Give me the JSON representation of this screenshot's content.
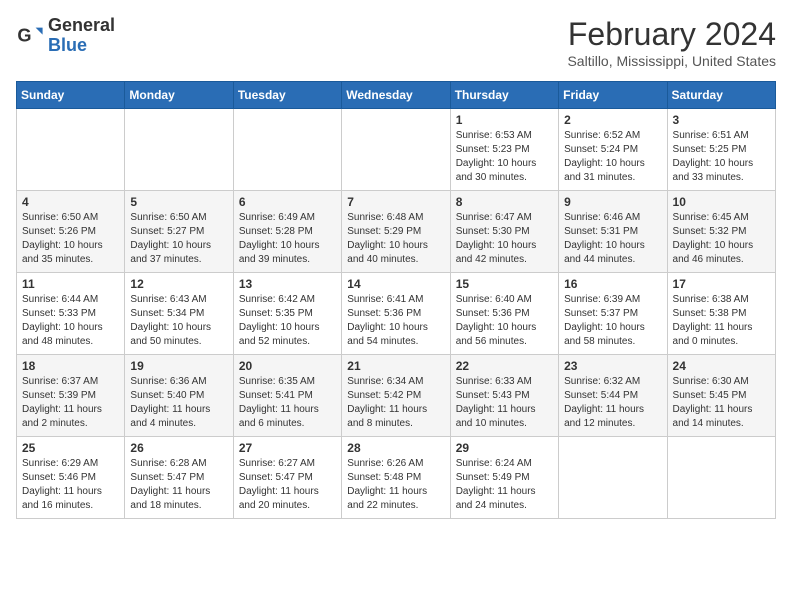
{
  "header": {
    "logo_general": "General",
    "logo_blue": "Blue",
    "month_title": "February 2024",
    "subtitle": "Saltillo, Mississippi, United States"
  },
  "days_of_week": [
    "Sunday",
    "Monday",
    "Tuesday",
    "Wednesday",
    "Thursday",
    "Friday",
    "Saturday"
  ],
  "weeks": [
    [
      {
        "day": "",
        "text": ""
      },
      {
        "day": "",
        "text": ""
      },
      {
        "day": "",
        "text": ""
      },
      {
        "day": "",
        "text": ""
      },
      {
        "day": "1",
        "text": "Sunrise: 6:53 AM\nSunset: 5:23 PM\nDaylight: 10 hours and 30 minutes."
      },
      {
        "day": "2",
        "text": "Sunrise: 6:52 AM\nSunset: 5:24 PM\nDaylight: 10 hours and 31 minutes."
      },
      {
        "day": "3",
        "text": "Sunrise: 6:51 AM\nSunset: 5:25 PM\nDaylight: 10 hours and 33 minutes."
      }
    ],
    [
      {
        "day": "4",
        "text": "Sunrise: 6:50 AM\nSunset: 5:26 PM\nDaylight: 10 hours and 35 minutes."
      },
      {
        "day": "5",
        "text": "Sunrise: 6:50 AM\nSunset: 5:27 PM\nDaylight: 10 hours and 37 minutes."
      },
      {
        "day": "6",
        "text": "Sunrise: 6:49 AM\nSunset: 5:28 PM\nDaylight: 10 hours and 39 minutes."
      },
      {
        "day": "7",
        "text": "Sunrise: 6:48 AM\nSunset: 5:29 PM\nDaylight: 10 hours and 40 minutes."
      },
      {
        "day": "8",
        "text": "Sunrise: 6:47 AM\nSunset: 5:30 PM\nDaylight: 10 hours and 42 minutes."
      },
      {
        "day": "9",
        "text": "Sunrise: 6:46 AM\nSunset: 5:31 PM\nDaylight: 10 hours and 44 minutes."
      },
      {
        "day": "10",
        "text": "Sunrise: 6:45 AM\nSunset: 5:32 PM\nDaylight: 10 hours and 46 minutes."
      }
    ],
    [
      {
        "day": "11",
        "text": "Sunrise: 6:44 AM\nSunset: 5:33 PM\nDaylight: 10 hours and 48 minutes."
      },
      {
        "day": "12",
        "text": "Sunrise: 6:43 AM\nSunset: 5:34 PM\nDaylight: 10 hours and 50 minutes."
      },
      {
        "day": "13",
        "text": "Sunrise: 6:42 AM\nSunset: 5:35 PM\nDaylight: 10 hours and 52 minutes."
      },
      {
        "day": "14",
        "text": "Sunrise: 6:41 AM\nSunset: 5:36 PM\nDaylight: 10 hours and 54 minutes."
      },
      {
        "day": "15",
        "text": "Sunrise: 6:40 AM\nSunset: 5:36 PM\nDaylight: 10 hours and 56 minutes."
      },
      {
        "day": "16",
        "text": "Sunrise: 6:39 AM\nSunset: 5:37 PM\nDaylight: 10 hours and 58 minutes."
      },
      {
        "day": "17",
        "text": "Sunrise: 6:38 AM\nSunset: 5:38 PM\nDaylight: 11 hours and 0 minutes."
      }
    ],
    [
      {
        "day": "18",
        "text": "Sunrise: 6:37 AM\nSunset: 5:39 PM\nDaylight: 11 hours and 2 minutes."
      },
      {
        "day": "19",
        "text": "Sunrise: 6:36 AM\nSunset: 5:40 PM\nDaylight: 11 hours and 4 minutes."
      },
      {
        "day": "20",
        "text": "Sunrise: 6:35 AM\nSunset: 5:41 PM\nDaylight: 11 hours and 6 minutes."
      },
      {
        "day": "21",
        "text": "Sunrise: 6:34 AM\nSunset: 5:42 PM\nDaylight: 11 hours and 8 minutes."
      },
      {
        "day": "22",
        "text": "Sunrise: 6:33 AM\nSunset: 5:43 PM\nDaylight: 11 hours and 10 minutes."
      },
      {
        "day": "23",
        "text": "Sunrise: 6:32 AM\nSunset: 5:44 PM\nDaylight: 11 hours and 12 minutes."
      },
      {
        "day": "24",
        "text": "Sunrise: 6:30 AM\nSunset: 5:45 PM\nDaylight: 11 hours and 14 minutes."
      }
    ],
    [
      {
        "day": "25",
        "text": "Sunrise: 6:29 AM\nSunset: 5:46 PM\nDaylight: 11 hours and 16 minutes."
      },
      {
        "day": "26",
        "text": "Sunrise: 6:28 AM\nSunset: 5:47 PM\nDaylight: 11 hours and 18 minutes."
      },
      {
        "day": "27",
        "text": "Sunrise: 6:27 AM\nSunset: 5:47 PM\nDaylight: 11 hours and 20 minutes."
      },
      {
        "day": "28",
        "text": "Sunrise: 6:26 AM\nSunset: 5:48 PM\nDaylight: 11 hours and 22 minutes."
      },
      {
        "day": "29",
        "text": "Sunrise: 6:24 AM\nSunset: 5:49 PM\nDaylight: 11 hours and 24 minutes."
      },
      {
        "day": "",
        "text": ""
      },
      {
        "day": "",
        "text": ""
      }
    ]
  ]
}
